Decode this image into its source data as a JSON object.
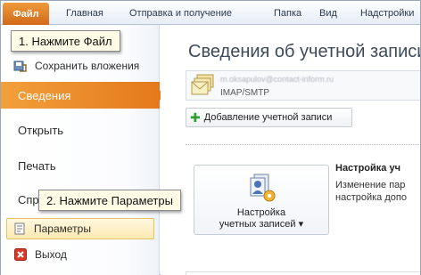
{
  "ribbon": {
    "file_tab": "Файл",
    "tabs": [
      "Главная",
      "Отправка и получение",
      "Папка",
      "Вид",
      "Надстройки"
    ]
  },
  "sidebar": {
    "items": [
      {
        "label": "Сохранить вложения",
        "icon": "save-attachments-icon"
      },
      {
        "label": "Сведения",
        "active": true
      },
      {
        "label": "Открыть"
      },
      {
        "label": "Печать"
      },
      {
        "label": "Спр"
      },
      {
        "label": "Параметры",
        "icon": "document-icon",
        "highlighted": true
      },
      {
        "label": "Выход",
        "icon": "exit-icon"
      }
    ]
  },
  "callouts": {
    "step1": "1. Нажмите Файл",
    "step2": "2. Нажмите Параметры"
  },
  "main": {
    "title": "Сведения об учетной записи",
    "account": {
      "email": "m.oksapulov@contact-inform.ru",
      "protocol": "IMAP/SMTP"
    },
    "add_account_button": "Добавление учетной записи",
    "account_settings_button": [
      "Настройка",
      "учетных записей"
    ],
    "account_settings_dropdown": "▾",
    "settings_heading": "Настройка уч",
    "settings_description": "Изменение пар настройка допо"
  },
  "colors": {
    "accent_orange": "#e47a1c",
    "file_tab": "#d2691a",
    "plus_green": "#2f9e2f"
  }
}
